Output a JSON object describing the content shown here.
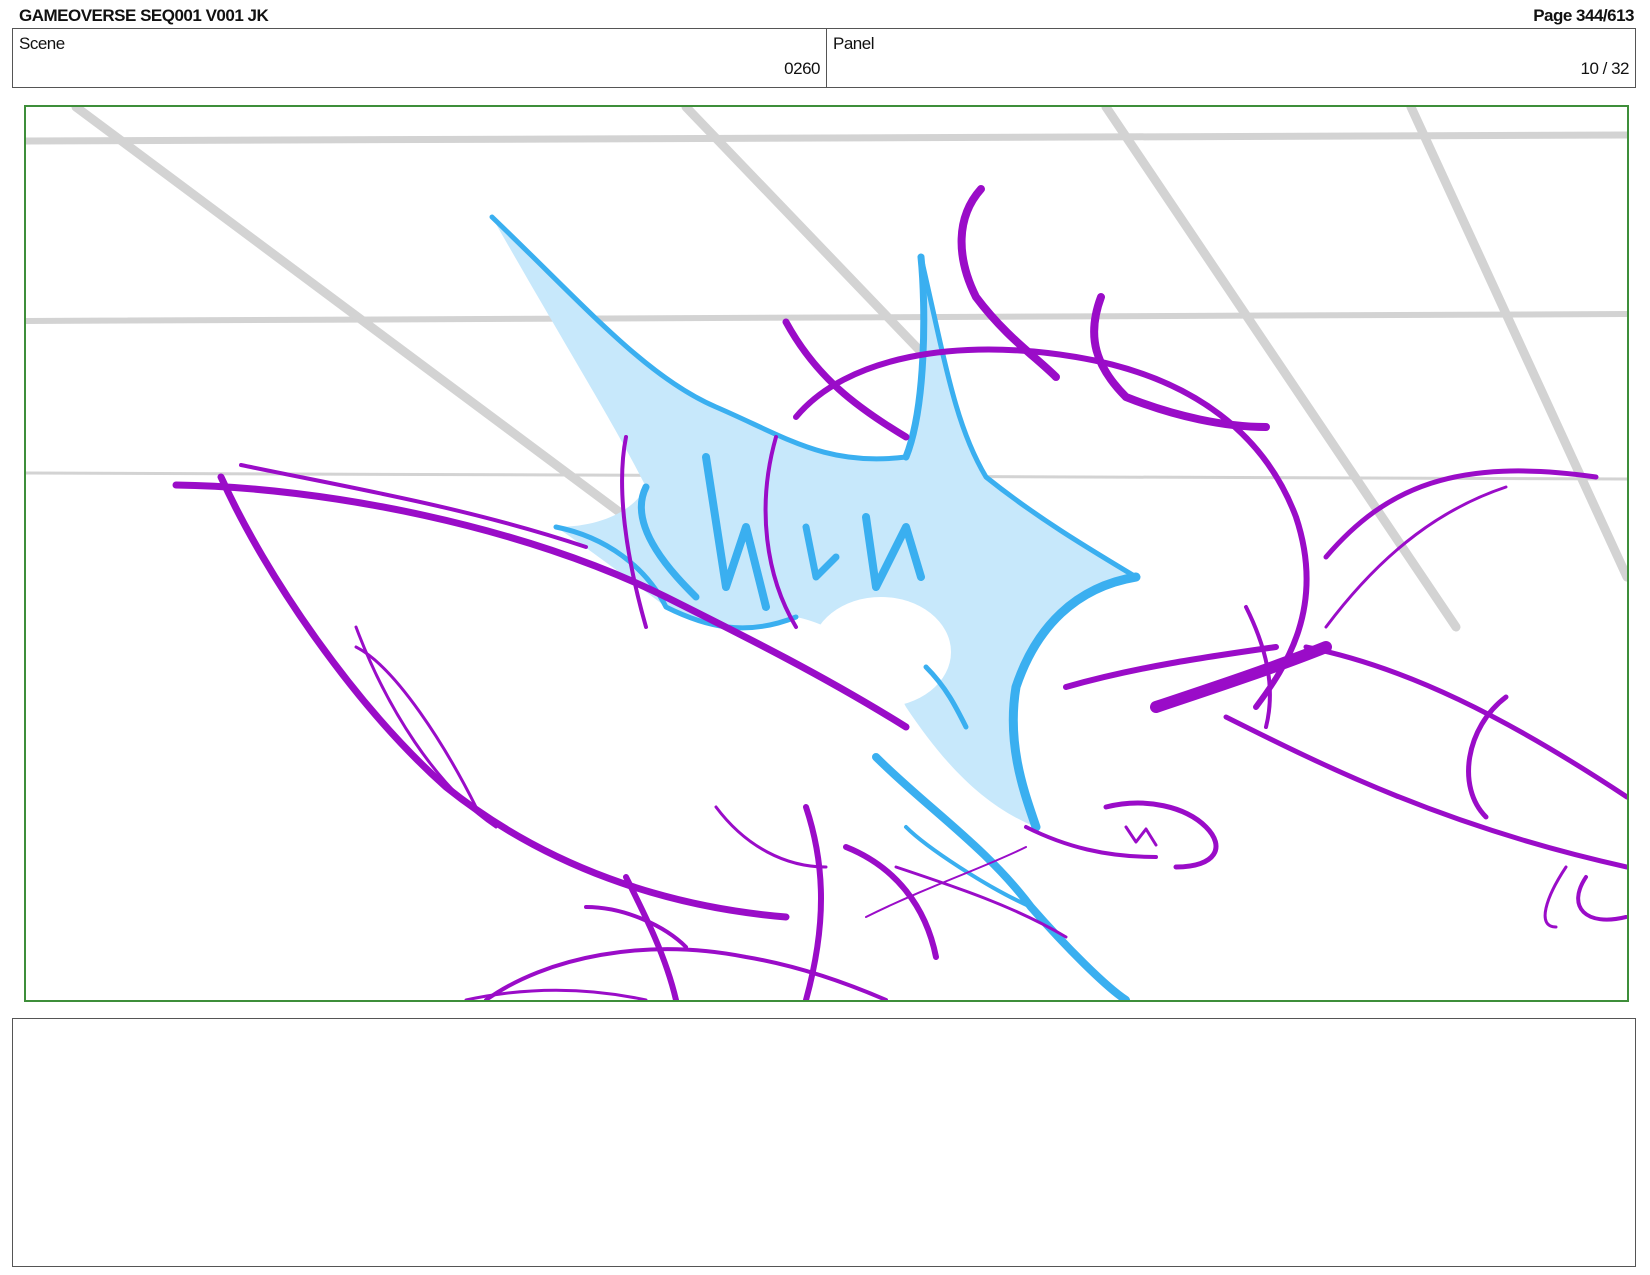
{
  "header": {
    "doc_title": "GAMEOVERSE SEQ001 V001 JK",
    "page": "Page 344/613"
  },
  "info": {
    "scene_label": "Scene",
    "scene_value": "0260",
    "panel_label": "Panel",
    "panel_value": "10 / 32"
  },
  "panel_art": {
    "colors": {
      "frame_border": "#3e8e3a",
      "grid_lines": "#d3d3d3",
      "character_lines": "#9a0cc8",
      "effect_stroke": "#3aaff0",
      "effect_fill": "#c7e8fb"
    }
  },
  "notes": {
    "text": ""
  }
}
